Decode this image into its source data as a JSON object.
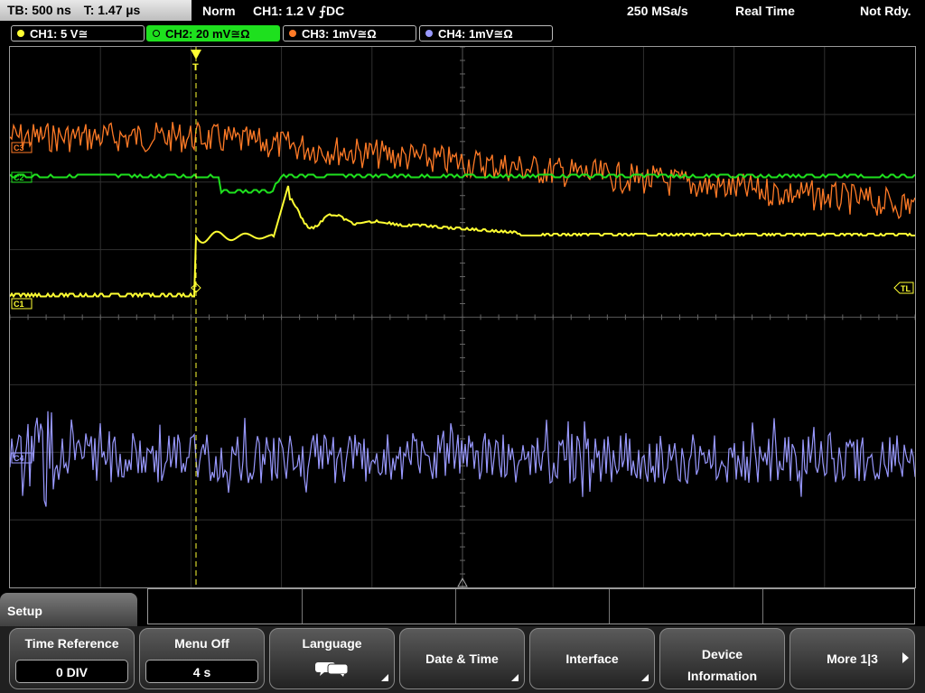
{
  "status": {
    "timebase": "TB: 500 ns",
    "trigger_time": "T: 1.47 µs",
    "mode": "Norm",
    "trigger": "CH1: 1.2 V ⨍DC",
    "sample_rate": "250 MSa/s",
    "acq_mode": "Real Time",
    "state": "Not Rdy."
  },
  "channels": [
    {
      "label": "CH1: 5 V≅",
      "color": "#ffff33"
    },
    {
      "label": "CH2: 20 mV≅Ω",
      "color": "#1ee01e"
    },
    {
      "label": "CH3: 1mV≅Ω",
      "color": "#ff7a26"
    },
    {
      "label": "CH4: 1mV≅Ω",
      "color": "#9999ff"
    }
  ],
  "markers": {
    "ch3": "C3",
    "ch2": "C2",
    "ch1": "C1",
    "ch4": "C4",
    "trigger_level": "TL",
    "trigger_pos": "T"
  },
  "menu": {
    "title": "Setup",
    "keys": [
      {
        "label": "Time Reference",
        "value": "0 DIV"
      },
      {
        "label": "Menu Off",
        "value": "4 s"
      },
      {
        "label": "Language",
        "icon": "speech-bubbles-icon"
      },
      {
        "label": "Date & Time"
      },
      {
        "label": "Interface"
      },
      {
        "label": "Device Information"
      },
      {
        "label": "More 1|3"
      }
    ]
  }
}
